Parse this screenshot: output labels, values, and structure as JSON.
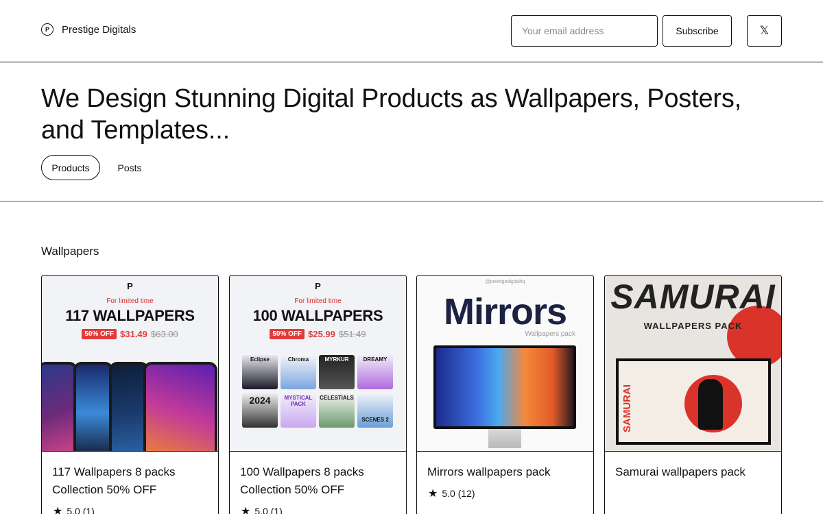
{
  "header": {
    "brand_icon": "prestige-logo-icon",
    "brand_name": "Prestige Digitals",
    "email_placeholder": "Your email address",
    "subscribe_label": "Subscribe",
    "x_icon": "𝕏"
  },
  "hero": {
    "headline": "We Design Stunning Digital Products as Wallpapers, Posters, and Templates...",
    "tabs": [
      {
        "label": "Products",
        "active": true
      },
      {
        "label": "Posts",
        "active": false
      }
    ]
  },
  "section": {
    "title": "Wallpapers",
    "cards": [
      {
        "title": "117 Wallpapers 8 packs Collection 50% OFF",
        "rating": "5.0 (1)",
        "art": {
          "logo": "P",
          "limited": "For limited time",
          "headline": "117 WALLPAPERS",
          "badge": "50% OFF",
          "price_now": "$31.49",
          "price_old": "$63.00"
        }
      },
      {
        "title": "100 Wallpapers 8 packs Collection 50% OFF",
        "rating": "5.0 (1)",
        "art": {
          "logo": "P",
          "limited": "For limited time",
          "headline": "100 WALLPAPERS",
          "badge": "50% OFF",
          "price_now": "$25.99",
          "price_old": "$51.49",
          "tiles": [
            "Eclipse",
            "Chroma",
            "MYRKUR",
            "DREAMY",
            "2024",
            "MYSTICAL PACK",
            "CELESTIALS",
            "SCENES 2"
          ]
        }
      },
      {
        "title": "Mirrors wallpapers pack",
        "rating": "5.0 (12)",
        "art": {
          "handle": "@prestigedigitalhq",
          "headline": "Mirrors",
          "sub": "Wallpapers pack"
        }
      },
      {
        "title": "Samurai wallpapers pack",
        "art": {
          "headline": "SAMURAI",
          "sub": "WALLPAPERS PACK",
          "vertical": "SAMURAI"
        }
      }
    ]
  },
  "colors": {
    "accent_red": "#e23b3b",
    "mirrors_navy": "#1b2243",
    "samurai_red": "#d9332a"
  }
}
